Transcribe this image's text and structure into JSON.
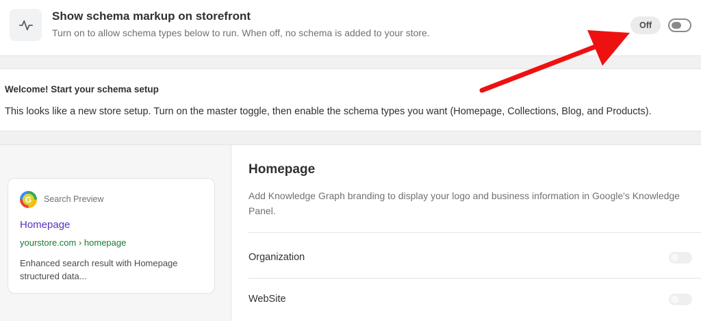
{
  "master": {
    "title": "Show schema markup on storefront",
    "description": "Turn on to allow schema types below to run. When off, no schema is added to your store.",
    "status_label": "Off",
    "toggle_state": "off",
    "icon": "activity-pulse-icon"
  },
  "welcome": {
    "title": "Welcome! Start your schema setup",
    "text": "This looks like a new store setup. Turn on the master toggle, then enable the schema types you want (Homepage, Collections, Blog, and Products)."
  },
  "preview": {
    "label": "Search Preview",
    "logo_letter": "G",
    "title": "Homepage",
    "url": "yourstore.com › homepage",
    "description": "Enhanced search result with Homepage structured data..."
  },
  "section": {
    "title": "Homepage",
    "description": "Add Knowledge Graph branding to display your logo and business information in Google's Knowledge Panel.",
    "rows": [
      {
        "label": "Organization",
        "enabled": false
      },
      {
        "label": "WebSite",
        "enabled": false
      }
    ]
  },
  "colors": {
    "accent_link": "#5b2fc4",
    "url_green": "#1b7a33",
    "annotation_arrow": "#ee1111"
  }
}
